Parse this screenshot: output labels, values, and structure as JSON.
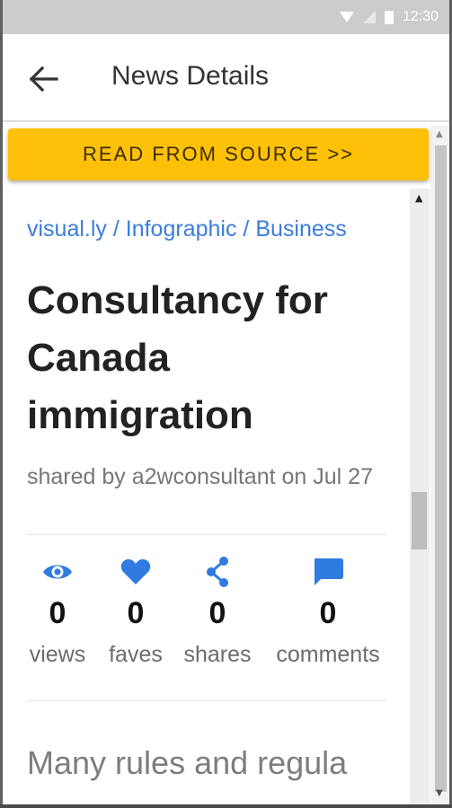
{
  "status_bar": {
    "time": "12:30"
  },
  "app_bar": {
    "title": "News Details"
  },
  "source_button": {
    "label": "READ FROM SOURCE >>"
  },
  "breadcrumb": {
    "source": "visual.ly",
    "sep1": " / ",
    "type": "Infographic",
    "sep2": " / ",
    "category": "Business"
  },
  "article": {
    "title": "Consultancy for Canada immigration",
    "meta": "shared by a2wconsultant on Jul 27",
    "body_preview": "Many rules and regula"
  },
  "stats": [
    {
      "icon": "eye-icon",
      "count": "0",
      "label": "views"
    },
    {
      "icon": "heart-icon",
      "count": "0",
      "label": "faves"
    },
    {
      "icon": "share-icon",
      "count": "0",
      "label": "shares"
    },
    {
      "icon": "comment-icon",
      "count": "0",
      "label": "comments"
    }
  ],
  "colors": {
    "accent": "#ffc107",
    "link": "#3b7ddd",
    "icon": "#2f7be0"
  }
}
